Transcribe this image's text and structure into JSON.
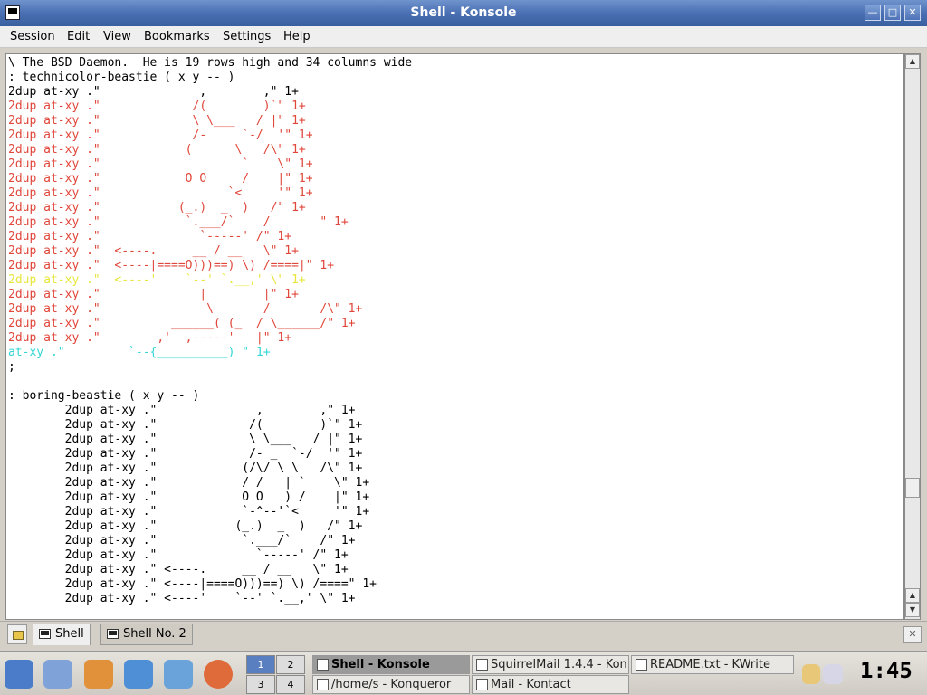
{
  "window": {
    "title": "Shell - Konsole"
  },
  "menu": {
    "items": [
      "Session",
      "Edit",
      "View",
      "Bookmarks",
      "Settings",
      "Help"
    ]
  },
  "terminal": {
    "lines": [
      "\\ The BSD Daemon.  He is 19 rows high and 34 columns wide",
      ": technicolor-beastie ( x y -- )",
      "2dup at-xy .\"              ,        ,\" 1+",
      "2dup at-xy .\"             /(        )`\" 1+",
      "2dup at-xy .\"             \\ \\___   / |\" 1+",
      "2dup at-xy .\"             /-     `-/  '\" 1+",
      "2dup at-xy .\"            (      \\   /\\\" 1+",
      "2dup at-xy .\"                    `    \\\" 1+",
      "2dup at-xy .\"            O O     /    |\" 1+",
      "2dup at-xy .\"                  `<     '\" 1+",
      "2dup at-xy .\"           (_.)  _  )   /\" 1+",
      "2dup at-xy .\"            `.___/`    /       \" 1+",
      "2dup at-xy .\"              `-----' /\" 1+",
      "2dup at-xy .\"  <----.     __ / __   \\\" 1+",
      "2dup at-xy .\"  <----|====O)))==) \\) /====|\" 1+",
      "2dup at-xy .\"  <----'    `--' `.__,' \\\" 1+",
      "2dup at-xy .\"              |        |\" 1+",
      "2dup at-xy .\"               \\       /       /\\\" 1+",
      "2dup at-xy .\"          ______( (_  / \\______/\" 1+",
      "2dup at-xy .\"        ,'  ,-----'   |\" 1+",
      "at-xy .\"         `--{__________) \" 1+",
      ";",
      "",
      ": boring-beastie ( x y -- )",
      "        2dup at-xy .\"              ,        ,\" 1+",
      "        2dup at-xy .\"             /(        )`\" 1+",
      "        2dup at-xy .\"             \\ \\___   / |\" 1+",
      "        2dup at-xy .\"             /- _  `-/  '\" 1+",
      "        2dup at-xy .\"            (/\\/ \\ \\   /\\\" 1+",
      "        2dup at-xy .\"            / /   | `    \\\" 1+",
      "        2dup at-xy .\"            O O   ) /    |\" 1+",
      "        2dup at-xy .\"            `-^--'`<     '\" 1+",
      "        2dup at-xy .\"           (_.)  _  )   /\" 1+",
      "        2dup at-xy .\"            `.___/`    /\" 1+",
      "        2dup at-xy .\"              `-----' /\" 1+",
      "        2dup at-xy .\" <----.     __ / __   \\\" 1+",
      "        2dup at-xy .\" <----|====O)))==) \\) /====\" 1+",
      "        2dup at-xy .\" <----'    `--' `.__,' \\\" 1+"
    ],
    "line_colors": [
      "#000000",
      "#000000",
      "#000000",
      "#e0463a",
      "#e0463a",
      "#e0463a",
      "#e0463a",
      "#e0463a",
      "#e0463a",
      "#e0463a",
      "#e0463a",
      "#e0463a",
      "#e0463a",
      "#e0463a",
      "#e0463a",
      "#e8e63a",
      "#e0463a",
      "#e0463a",
      "#e0463a",
      "#e0463a",
      "#33d6d6",
      "#000000",
      "#000000",
      "#000000",
      "#000000",
      "#000000",
      "#000000",
      "#000000",
      "#000000",
      "#000000",
      "#000000",
      "#000000",
      "#000000",
      "#000000",
      "#000000",
      "#000000",
      "#000000",
      "#000000"
    ]
  },
  "tabs": [
    {
      "label": "Shell",
      "active": true
    },
    {
      "label": "Shell No. 2",
      "active": false
    }
  ],
  "taskbar": {
    "desktops": [
      "1",
      "2",
      "3",
      "4"
    ],
    "tasks": [
      {
        "label": "Shell - Konsole",
        "active": true
      },
      {
        "label": "SquirrelMail 1.4.4 - Kon",
        "active": false
      },
      {
        "label": "README.txt - KWrite",
        "active": false
      },
      {
        "label": "/home/s - Konqueror",
        "active": false
      },
      {
        "label": "Mail - Kontact",
        "active": false
      }
    ],
    "clock": "1:45"
  },
  "icons": [
    "konsole-icon",
    "kde-menu-icon",
    "kwrite-icon",
    "home-icon",
    "konqueror-icon",
    "kmail-icon",
    "help-icon"
  ]
}
